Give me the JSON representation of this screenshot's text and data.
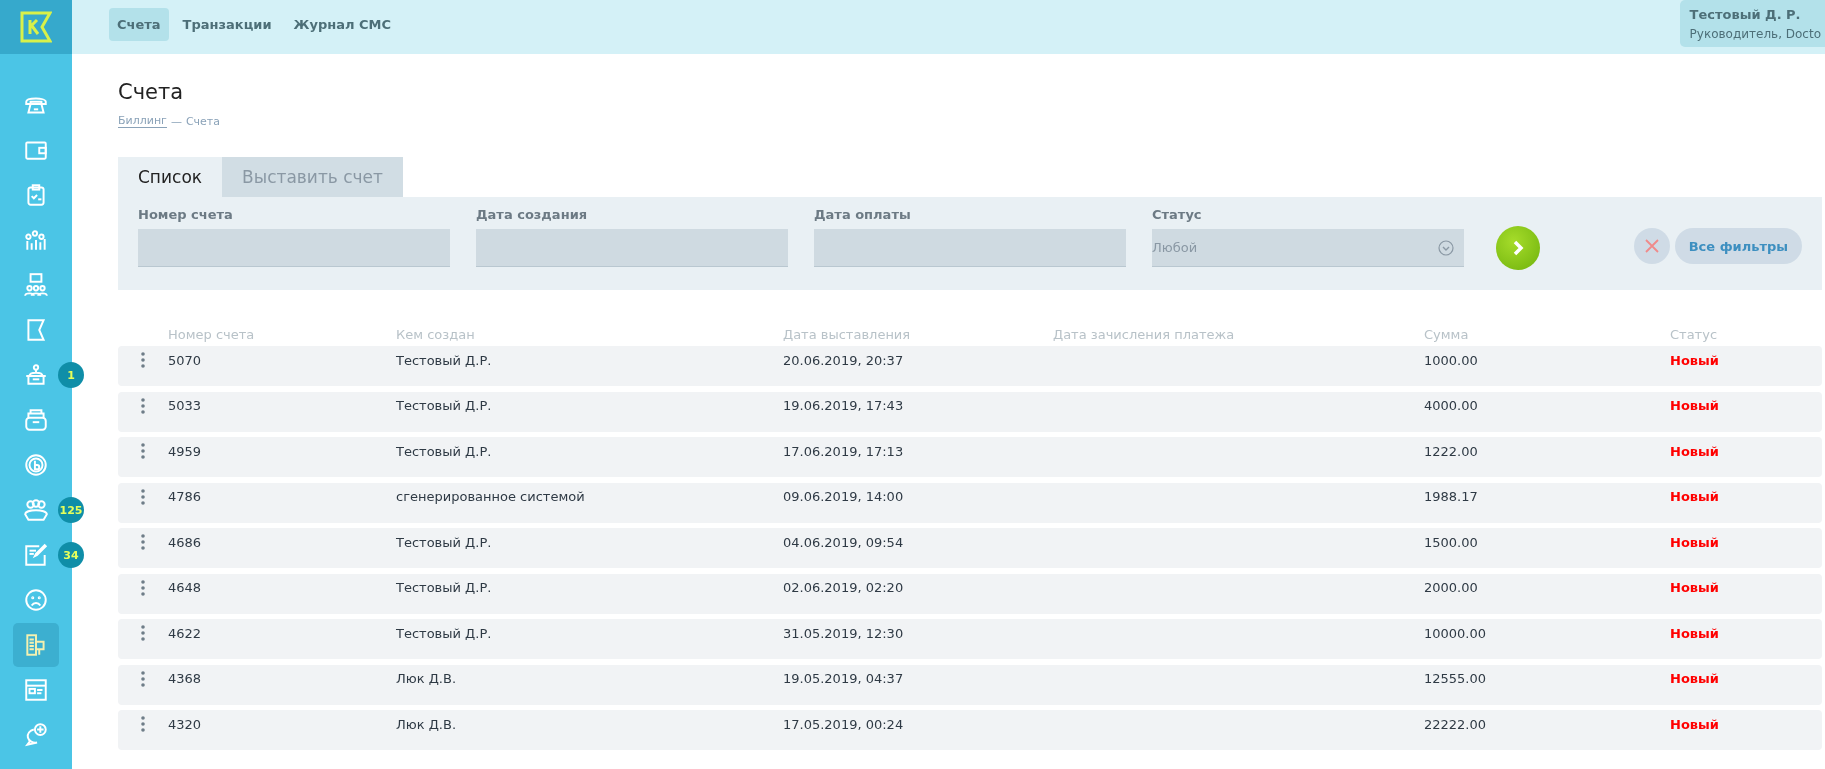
{
  "sidebar": {
    "items": [
      {
        "kind": "phone",
        "selected": false
      },
      {
        "kind": "wallet",
        "selected": false
      },
      {
        "kind": "clipboard",
        "selected": false
      },
      {
        "kind": "chart",
        "selected": false
      },
      {
        "kind": "people",
        "selected": false
      },
      {
        "kind": "flag",
        "selected": false
      },
      {
        "kind": "desk",
        "selected": false,
        "badge": "1"
      },
      {
        "kind": "archive",
        "selected": false
      },
      {
        "kind": "coin",
        "selected": false
      },
      {
        "kind": "group",
        "selected": false,
        "badge": "125"
      },
      {
        "kind": "edit",
        "selected": false,
        "badge": "34"
      },
      {
        "kind": "sad",
        "selected": false
      },
      {
        "kind": "building",
        "selected": true
      },
      {
        "kind": "browser",
        "selected": false
      },
      {
        "kind": "chatplus",
        "selected": false
      }
    ]
  },
  "nav": {
    "tabs": [
      {
        "label": "Счета",
        "selected": true
      },
      {
        "label": "Транзакции",
        "selected": false
      },
      {
        "label": "Журнал СМС",
        "selected": false
      }
    ]
  },
  "user": {
    "name": "Тестовый Д. Р.",
    "role": "Руководитель, Docto"
  },
  "page": {
    "title": "Счета",
    "breadcrumb": {
      "link": "Биллинг",
      "separator": "—",
      "current": "Счета"
    }
  },
  "tabs": [
    {
      "label": "Список",
      "selected": true
    },
    {
      "label": "Выставить счет",
      "selected": false
    }
  ],
  "filters": {
    "fields": [
      {
        "label": "Номер счета",
        "kind": "text"
      },
      {
        "label": "Дата создания",
        "kind": "text"
      },
      {
        "label": "Дата оплаты",
        "kind": "text"
      },
      {
        "label": "Статус",
        "kind": "select",
        "value": "Любой"
      }
    ],
    "all_filters": "Все фильтры"
  },
  "table": {
    "columns": [
      "Номер счета",
      "Кем создан",
      "Дата выставления",
      "Дата зачисления платежа",
      "Сумма",
      "Статус"
    ],
    "rows": [
      {
        "number": "5070",
        "creator": "Тестовый Д.Р.",
        "issued": "20.06.2019, 20:37",
        "sum": "1000.00",
        "status": "Новый"
      },
      {
        "number": "5033",
        "creator": "Тестовый Д.Р.",
        "issued": "19.06.2019, 17:43",
        "sum": "4000.00",
        "status": "Новый"
      },
      {
        "number": "4959",
        "creator": "Тестовый Д.Р.",
        "issued": "17.06.2019, 17:13",
        "sum": "1222.00",
        "status": "Новый"
      },
      {
        "number": "4786",
        "creator": "сгенерированное системой",
        "issued": "09.06.2019, 14:00",
        "sum": "1988.17",
        "status": "Новый"
      },
      {
        "number": "4686",
        "creator": "Тестовый Д.Р.",
        "issued": "04.06.2019, 09:54",
        "sum": "1500.00",
        "status": "Новый"
      },
      {
        "number": "4648",
        "creator": "Тестовый Д.Р.",
        "issued": "02.06.2019, 02:20",
        "sum": "2000.00",
        "status": "Новый"
      },
      {
        "number": "4622",
        "creator": "Тестовый Д.Р.",
        "issued": "31.05.2019, 12:30",
        "sum": "10000.00",
        "status": "Новый"
      },
      {
        "number": "4368",
        "creator": "Люк Д.В.",
        "issued": "19.05.2019, 04:37",
        "sum": "12555.00",
        "status": "Новый"
      },
      {
        "number": "4320",
        "creator": "Люк Д.В.",
        "issued": "17.05.2019, 00:24",
        "sum": "22222.00",
        "status": "Новый"
      }
    ]
  }
}
